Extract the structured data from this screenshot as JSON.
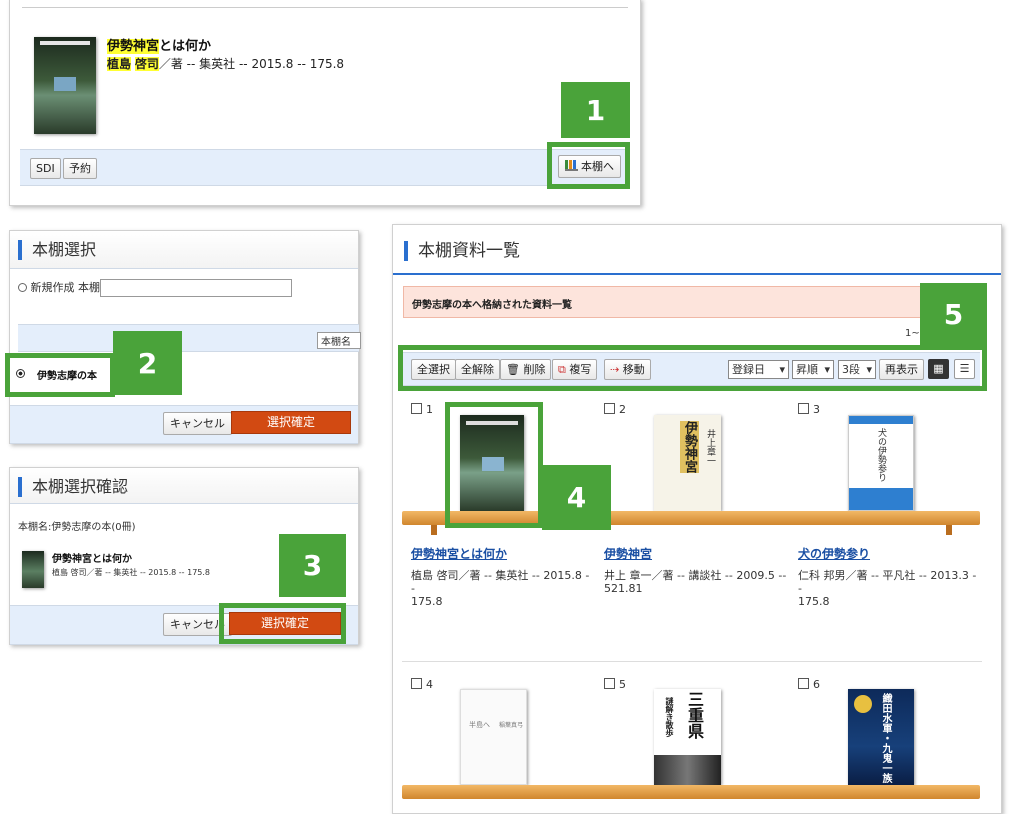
{
  "p1": {
    "book_title_hl": "伊勢神宮",
    "book_title_rest": "とは何か",
    "author_hl1": "植島",
    "author_hl2": "啓司",
    "meta": "／著 -- 集英社 -- 2015.8 -- 175.8",
    "sdi": "SDI",
    "reserve": "予約",
    "shelf_button": "本棚へ",
    "badge": "1"
  },
  "p2": {
    "title": "本棚選択",
    "new_label": "新規作成 本棚名",
    "col_header": "本棚名",
    "shelf_name": "伊勢志摩の本",
    "cancel": "キャンセル",
    "confirm": "選択確定",
    "badge": "2"
  },
  "p3": {
    "title": "本棚選択確認",
    "shelf_line": "本棚名:伊勢志摩の本(0冊)",
    "book_title": "伊勢神宮とは何か",
    "book_meta": "植島 啓司／著 -- 集英社 -- 2015.8 -- 175.8",
    "cancel": "キャンセル",
    "confirm": "選択確定",
    "badge": "3"
  },
  "p4": {
    "title": "本棚資料一覧",
    "banner": "伊勢志摩の本へ格納された資料一覧",
    "count": "1~",
    "toolbar": {
      "select_all": "全選択",
      "deselect_all": "全解除",
      "delete": "削除",
      "copy": "複写",
      "move": "移動",
      "sort": "登録日",
      "order": "昇順",
      "rows": "3段",
      "redisplay": "再表示"
    },
    "badge4": "4",
    "badge5": "5",
    "items": [
      {
        "num": "1",
        "title": "伊勢神宮とは何か",
        "meta1": "植島 啓司／著 -- 集英社 -- 2015.8 --",
        "meta2": "175.8"
      },
      {
        "num": "2",
        "title": "伊勢神宮",
        "meta1": "井上 章一／著 -- 講談社 -- 2009.5 --",
        "meta2": "521.81"
      },
      {
        "num": "3",
        "title": "犬の伊勢参り",
        "meta1": "仁科 邦男／著 -- 平凡社 -- 2013.3 --",
        "meta2": "175.8"
      },
      {
        "num": "4"
      },
      {
        "num": "5"
      },
      {
        "num": "6"
      }
    ],
    "cover_texts": {
      "c2": "伊勢神宮",
      "c2b": "井上章一",
      "c3": "犬の伊勢参り",
      "c4a": "半島へ",
      "c4b": "稲葉真弓",
      "c5": "三重県",
      "c5b": "謎解き散歩",
      "c6": "織田水軍・九鬼一族"
    }
  }
}
